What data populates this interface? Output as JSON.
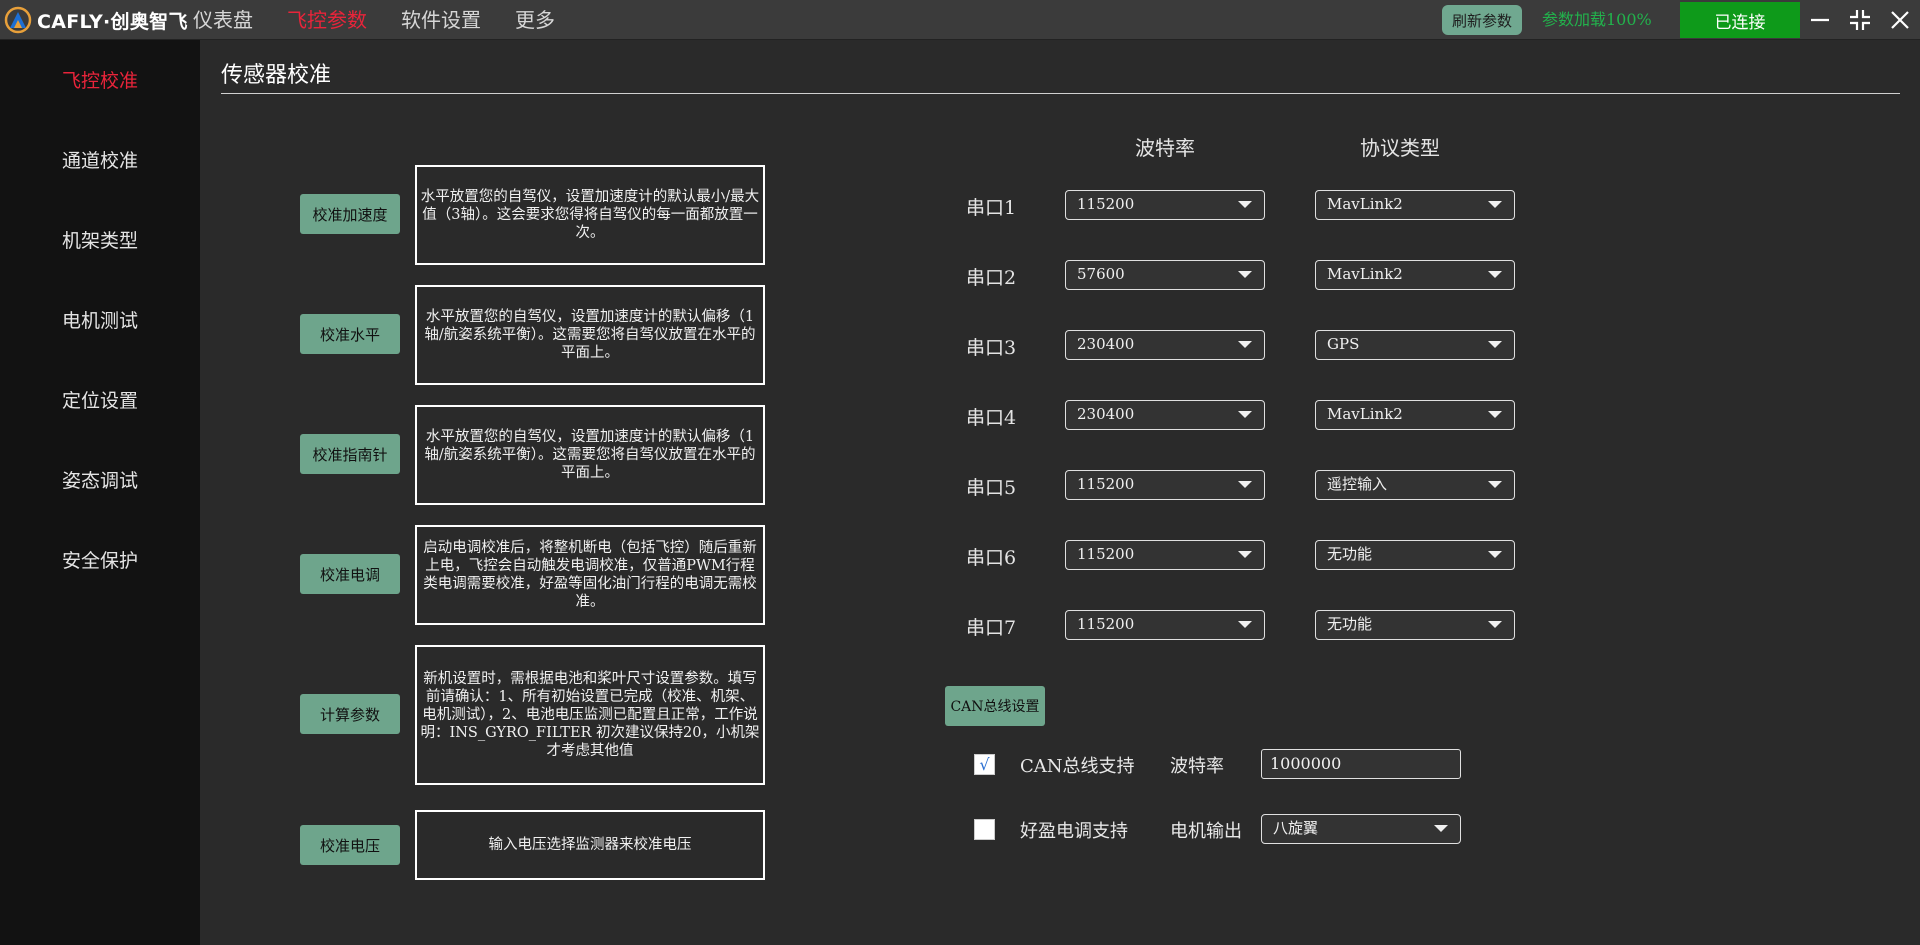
{
  "app": {
    "logo_text": "CAFLY·创奥智飞"
  },
  "nav": {
    "items": [
      "仪表盘",
      "飞控参数",
      "软件设置",
      "更多"
    ],
    "active_index": 1
  },
  "toolbar": {
    "refresh_label": "刷新参数",
    "load_status": "参数加载100%",
    "connect_label": "已连接"
  },
  "sidebar": {
    "items": [
      "飞控校准",
      "通道校准",
      "机架类型",
      "电机测试",
      "定位设置",
      "姿态调试",
      "安全保护"
    ],
    "active_index": 0
  },
  "page": {
    "title": "传感器校准"
  },
  "calibration": [
    {
      "button": "校准加速度",
      "desc": "水平放置您的自驾仪，设置加速度计的默认最小/最大值（3轴）。这会要求您得将自驾仪的每一面都放置一次。"
    },
    {
      "button": "校准水平",
      "desc": "水平放置您的自驾仪，设置加速度计的默认偏移（1轴/航姿系统平衡）。这需要您将自驾仪放置在水平的平面上。"
    },
    {
      "button": "校准指南针",
      "desc": "水平放置您的自驾仪，设置加速度计的默认偏移（1轴/航姿系统平衡）。这需要您将自驾仪放置在水平的平面上。"
    },
    {
      "button": "校准电调",
      "desc": "启动电调校准后，将整机断电（包括飞控）随后重新上电，飞控会自动触发电调校准，仅普通PWM行程类电调需要校准，好盈等固化油门行程的电调无需校准。"
    },
    {
      "button": "计算参数",
      "desc": "新机设置时，需根据电池和桨叶尺寸设置参数。填写前请确认：1、所有初始设置已完成（校准、机架、电机测试），2、电池电压监测已配置且正常，工作说明：INS_GYRO_FILTER 初次建议保持20，小机架才考虑其他值"
    },
    {
      "button": "校准电压",
      "desc": "输入电压选择监测器来校准电压"
    }
  ],
  "serial": {
    "baud_header": "波特率",
    "protocol_header": "协议类型",
    "ports": [
      {
        "label": "串口1",
        "baud": "115200",
        "protocol": "MavLink2"
      },
      {
        "label": "串口2",
        "baud": "57600",
        "protocol": "MavLink2"
      },
      {
        "label": "串口3",
        "baud": "230400",
        "protocol": "GPS"
      },
      {
        "label": "串口4",
        "baud": "230400",
        "protocol": "MavLink2"
      },
      {
        "label": "串口5",
        "baud": "115200",
        "protocol": "遥控输入"
      },
      {
        "label": "串口6",
        "baud": "115200",
        "protocol": "无功能"
      },
      {
        "label": "串口7",
        "baud": "115200",
        "protocol": "无功能"
      }
    ]
  },
  "can": {
    "button_label": "CAN总线设置",
    "bus_support_label": "CAN总线支持",
    "bus_support_checked": true,
    "check_mark": "√",
    "baud_label": "波特率",
    "baud_value": "1000000",
    "esc_support_label": "好盈电调支持",
    "esc_support_checked": false,
    "motor_output_label": "电机输出",
    "motor_output_value": "八旋翼"
  },
  "colors": {
    "accent_red": "#e8243a",
    "button_green": "#6ea58c",
    "connected_green": "#0e9a1a",
    "status_green": "#22b24c"
  },
  "icons": {
    "logo": "cafly-logo-icon",
    "minimize": "minimize-icon",
    "restore": "restore-icon",
    "close": "close-icon",
    "dropdown": "chevron-down-icon"
  }
}
